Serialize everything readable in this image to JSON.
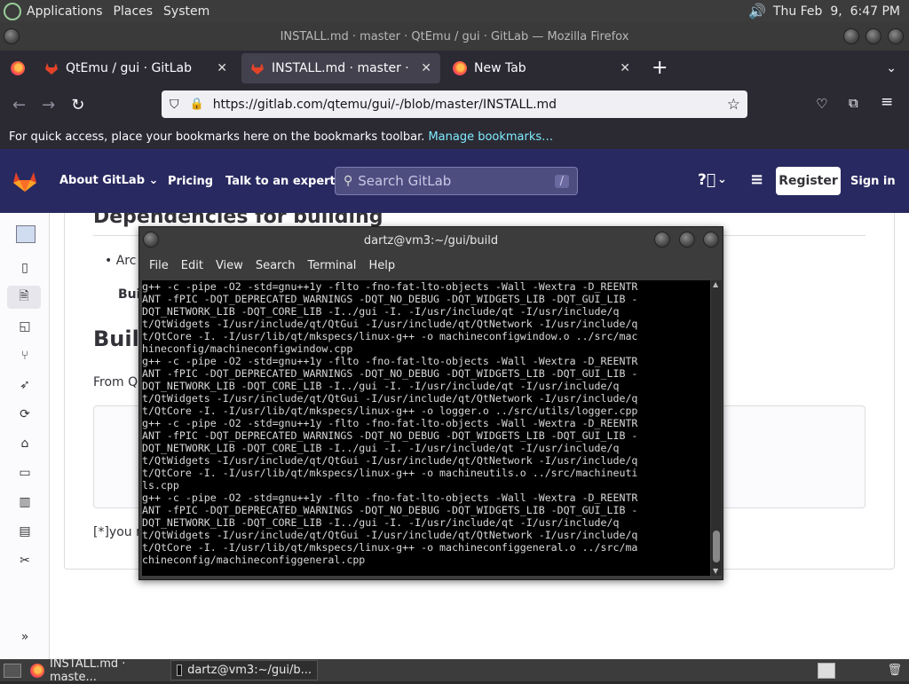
{
  "top_panel": {
    "menus": [
      "Applications",
      "Places",
      "System"
    ],
    "clock": "Thu Feb  9,  6:47 PM"
  },
  "window": {
    "title": "INSTALL.md · master · QtEmu / gui · GitLab — Mozilla Firefox"
  },
  "tabs": [
    {
      "label": "QtEmu / gui · GitLab",
      "icon": "gitlab-icon"
    },
    {
      "label": "INSTALL.md · master · QtEmu",
      "icon": "gitlab-icon"
    },
    {
      "label": "New Tab",
      "icon": "firefox-icon"
    }
  ],
  "address_bar": {
    "url": "https://gitlab.com/qtemu/gui/-/blob/master/INSTALL.md"
  },
  "bookmarks_bar": {
    "text": "For quick access, place your bookmarks here on the bookmarks toolbar.",
    "link": "Manage bookmarks…"
  },
  "gitlab_header": {
    "about": "About GitLab",
    "pricing": "Pricing",
    "talk": "Talk to an expert",
    "search_placeholder": "Search GitLab",
    "search_shortcut": "/",
    "register": "Register",
    "sign_in": "Sign in"
  },
  "content": {
    "heading_deps": "Dependencies for building",
    "bullet_1": "Arc",
    "bold_1": "Bui",
    "heading_build": "Build",
    "from_text": "From Q",
    "footnote": "[*]you n"
  },
  "terminal": {
    "title": "dartz@vm3:~/gui/build",
    "menu": [
      "File",
      "Edit",
      "View",
      "Search",
      "Terminal",
      "Help"
    ],
    "lines": [
      "g++ -c -pipe -O2 -std=gnu++1y -flto -fno-fat-lto-objects -Wall -Wextra -D_REENTR",
      "ANT -fPIC -DQT_DEPRECATED_WARNINGS -DQT_NO_DEBUG -DQT_WIDGETS_LIB -DQT_GUI_LIB -",
      "DQT_NETWORK_LIB -DQT_CORE_LIB -I../gui -I. -I/usr/include/qt -I/usr/include/q",
      "t/QtWidgets -I/usr/include/qt/QtGui -I/usr/include/qt/QtNetwork -I/usr/include/q",
      "t/QtCore -I. -I/usr/lib/qt/mkspecs/linux-g++ -o machineconfigwindow.o ../src/mac",
      "hineconfig/machineconfigwindow.cpp",
      "g++ -c -pipe -O2 -std=gnu++1y -flto -fno-fat-lto-objects -Wall -Wextra -D_REENTR",
      "ANT -fPIC -DQT_DEPRECATED_WARNINGS -DQT_NO_DEBUG -DQT_WIDGETS_LIB -DQT_GUI_LIB -",
      "DQT_NETWORK_LIB -DQT_CORE_LIB -I../gui -I. -I/usr/include/qt -I/usr/include/q",
      "t/QtWidgets -I/usr/include/qt/QtGui -I/usr/include/qt/QtNetwork -I/usr/include/q",
      "t/QtCore -I. -I/usr/lib/qt/mkspecs/linux-g++ -o logger.o ../src/utils/logger.cpp",
      "g++ -c -pipe -O2 -std=gnu++1y -flto -fno-fat-lto-objects -Wall -Wextra -D_REENTR",
      "ANT -fPIC -DQT_DEPRECATED_WARNINGS -DQT_NO_DEBUG -DQT_WIDGETS_LIB -DQT_GUI_LIB -",
      "DQT_NETWORK_LIB -DQT_CORE_LIB -I../gui -I. -I/usr/include/qt -I/usr/include/q",
      "t/QtWidgets -I/usr/include/qt/QtGui -I/usr/include/qt/QtNetwork -I/usr/include/q",
      "t/QtCore -I. -I/usr/lib/qt/mkspecs/linux-g++ -o machineutils.o ../src/machineuti",
      "ls.cpp",
      "g++ -c -pipe -O2 -std=gnu++1y -flto -fno-fat-lto-objects -Wall -Wextra -D_REENTR",
      "ANT -fPIC -DQT_DEPRECATED_WARNINGS -DQT_NO_DEBUG -DQT_WIDGETS_LIB -DQT_GUI_LIB -",
      "DQT_NETWORK_LIB -DQT_CORE_LIB -I../gui -I. -I/usr/include/qt -I/usr/include/q",
      "t/QtWidgets -I/usr/include/qt/QtGui -I/usr/include/qt/QtNetwork -I/usr/include/q",
      "t/QtCore -I. -I/usr/lib/qt/mkspecs/linux-g++ -o machineconfiggeneral.o ../src/ma",
      "chineconfig/machineconfiggeneral.cpp"
    ]
  },
  "taskbar": [
    {
      "label": "INSTALL.md · maste...",
      "icon": "firefox-icon"
    },
    {
      "label": "dartz@vm3:~/gui/b...",
      "icon": "terminal-icon"
    }
  ],
  "colors": {
    "gitlab_header": "#292961",
    "firefox_chrome": "#2b2a33",
    "link": "#80ebff"
  }
}
